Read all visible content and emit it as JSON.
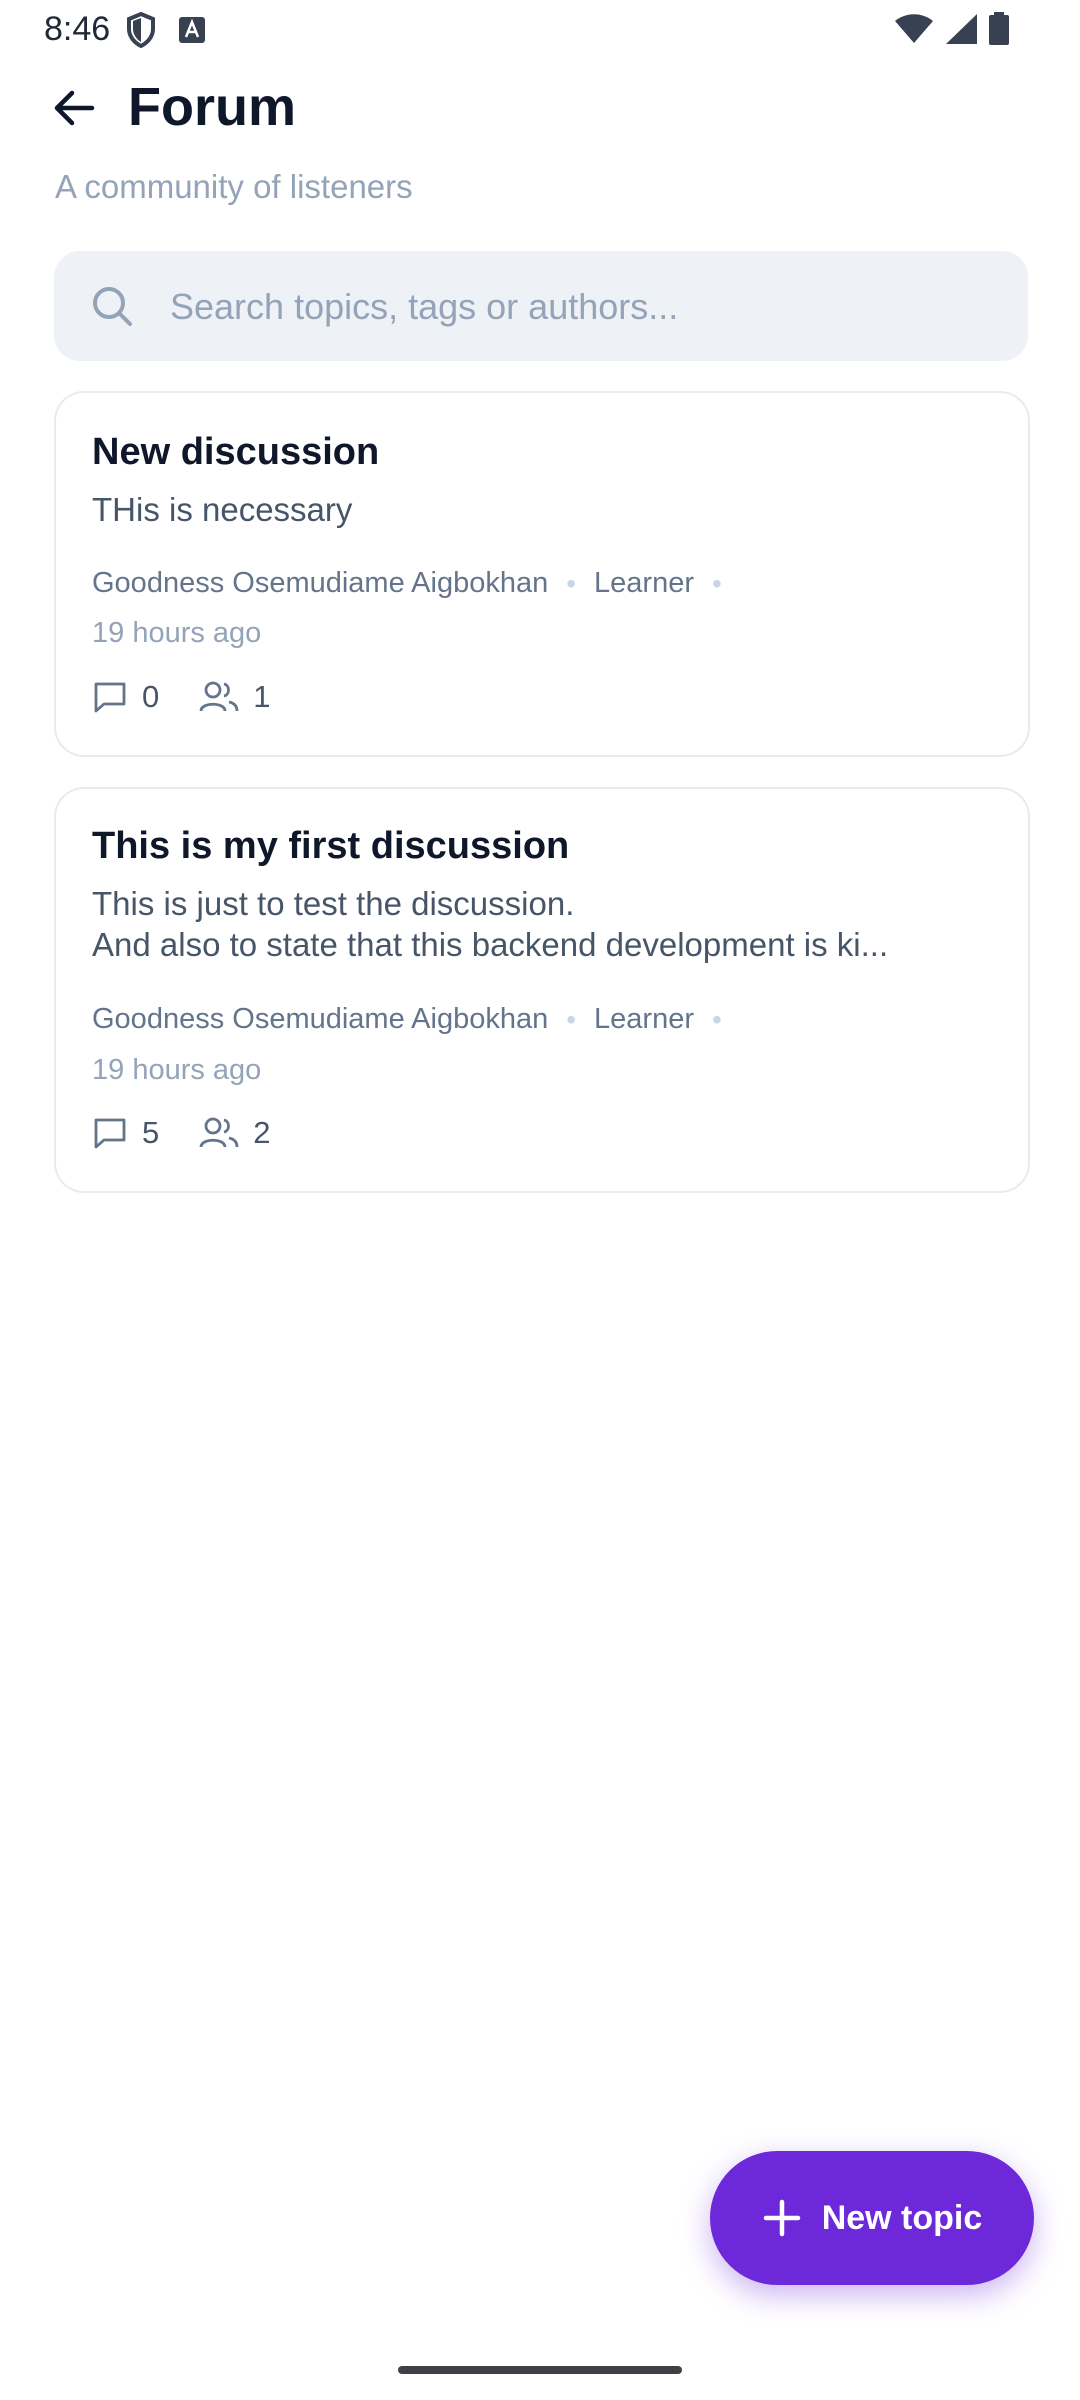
{
  "status_bar": {
    "time": "8:46",
    "left_icons": [
      "shield-icon",
      "app-notification-icon"
    ],
    "right_icons": [
      "wifi-icon",
      "signal-icon",
      "battery-icon"
    ]
  },
  "header": {
    "back_icon": "arrow-left-icon",
    "title": "Forum",
    "subtitle": "A community of listeners"
  },
  "search": {
    "placeholder": "Search topics, tags or authors...",
    "value": ""
  },
  "discussions": [
    {
      "title": "New discussion",
      "body_lines": [
        "THis is necessary"
      ],
      "author": "Goodness Osemudiame Aigbokhan",
      "role": "Learner",
      "time": "19 hours ago",
      "replies": "0",
      "participants": "1"
    },
    {
      "title": "This is my first discussion",
      "body_lines": [
        "This is just to test the discussion.",
        "And also to state that this backend development is ki..."
      ],
      "author": "Goodness Osemudiame Aigbokhan",
      "role": "Learner",
      "time": "19 hours ago",
      "replies": "5",
      "participants": "2"
    }
  ],
  "fab": {
    "label": "New topic",
    "icon": "plus-icon"
  },
  "colors": {
    "accent": "#6d28d9",
    "search_bg": "#eef2f7",
    "muted_text": "#94a3b8"
  }
}
